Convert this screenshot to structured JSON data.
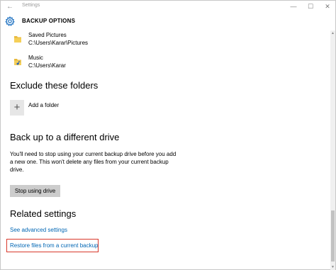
{
  "titlebar": {
    "back_glyph": "←",
    "title": "Settings",
    "minimize_glyph": "—",
    "maximize_glyph": "☐",
    "close_glyph": "✕"
  },
  "header": {
    "title": "BACKUP OPTIONS",
    "icon": "gear-icon"
  },
  "folders": [
    {
      "name": "Saved Pictures",
      "path": "C:\\Users\\Karar\\Pictures",
      "icon": "folder-icon"
    },
    {
      "name": "Music",
      "path": "C:\\Users\\Karar",
      "icon": "music-folder-icon"
    }
  ],
  "exclude": {
    "heading": "Exclude these folders",
    "add_glyph": "+",
    "add_label": "Add a folder"
  },
  "drive": {
    "heading": "Back up to a different drive",
    "lines": [
      "You'll need to stop using your current backup drive before you add",
      "a new one. This won't delete any files from your current backup",
      "drive."
    ],
    "stop_button": "Stop using drive"
  },
  "related": {
    "heading": "Related settings",
    "advanced_link": "See advanced settings",
    "restore_link": "Restore files from a current backup"
  },
  "colors": {
    "link": "#0066b4",
    "highlight_box": "#d9382b",
    "button_bg": "#cccccc"
  }
}
